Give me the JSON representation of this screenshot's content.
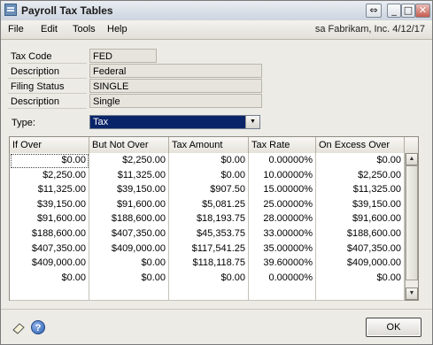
{
  "window": {
    "title": "Payroll Tax Tables",
    "controls": {
      "dots": "⇔",
      "min": "_",
      "max": "□",
      "close": "✕"
    }
  },
  "menu": {
    "items": [
      "File",
      "Edit",
      "Tools",
      "Help"
    ],
    "user_info": "sa  Fabrikam, Inc.  4/12/17"
  },
  "fields": {
    "tax_code": {
      "label": "Tax Code",
      "value": "FED"
    },
    "description": {
      "label": "Description",
      "value": "Federal"
    },
    "filing_status": {
      "label": "Filing Status",
      "value": "SINGLE"
    },
    "status_description": {
      "label": "Description",
      "value": "Single"
    }
  },
  "type_select": {
    "label": "Type:",
    "value": "Tax"
  },
  "grid": {
    "columns": [
      "If Over",
      "But Not Over",
      "Tax Amount",
      "Tax Rate",
      "On Excess Over"
    ],
    "rows": [
      [
        "$0.00",
        "$2,250.00",
        "$0.00",
        "0.00000%",
        "$0.00"
      ],
      [
        "$2,250.00",
        "$11,325.00",
        "$0.00",
        "10.00000%",
        "$2,250.00"
      ],
      [
        "$11,325.00",
        "$39,150.00",
        "$907.50",
        "15.00000%",
        "$11,325.00"
      ],
      [
        "$39,150.00",
        "$91,600.00",
        "$5,081.25",
        "25.00000%",
        "$39,150.00"
      ],
      [
        "$91,600.00",
        "$188,600.00",
        "$18,193.75",
        "28.00000%",
        "$91,600.00"
      ],
      [
        "$188,600.00",
        "$407,350.00",
        "$45,353.75",
        "33.00000%",
        "$188,600.00"
      ],
      [
        "$407,350.00",
        "$409,000.00",
        "$117,541.25",
        "35.00000%",
        "$407,350.00"
      ],
      [
        "$409,000.00",
        "$0.00",
        "$118,118.75",
        "39.60000%",
        "$409,000.00"
      ],
      [
        "$0.00",
        "$0.00",
        "$0.00",
        "0.00000%",
        "$0.00"
      ],
      [
        "",
        "",
        "",
        "",
        ""
      ]
    ]
  },
  "footer": {
    "ok_label": "OK",
    "note_icon": "note-icon",
    "help_icon": "help-icon",
    "help_glyph": "?"
  }
}
